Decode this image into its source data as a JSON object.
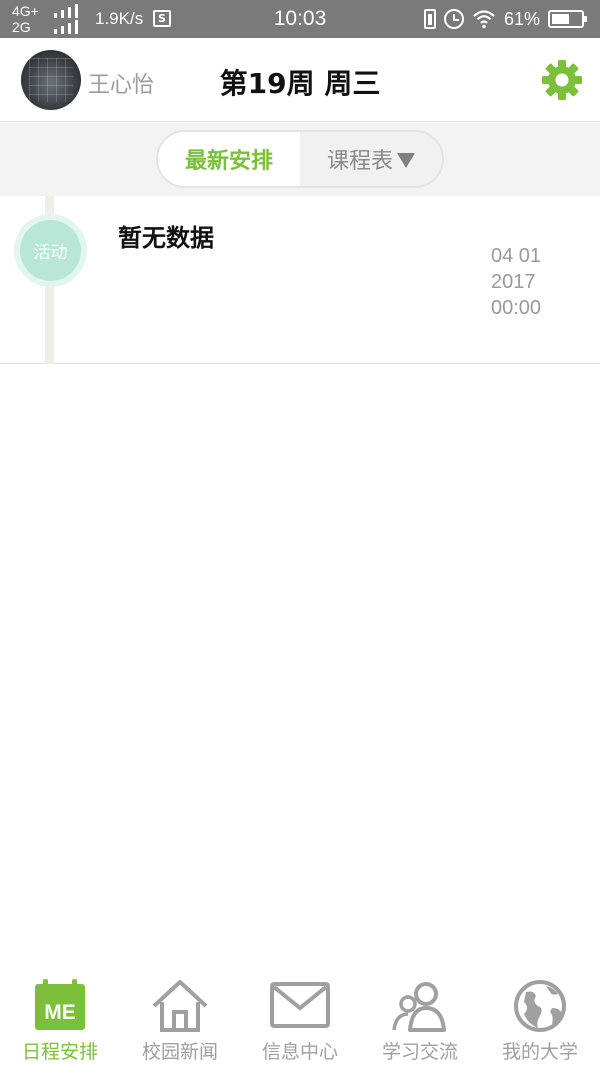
{
  "status_bar": {
    "network_top": "4G+",
    "network_bottom": "2G",
    "speed": "1.9K/s",
    "s_badge": "S",
    "time": "10:03",
    "battery": "61%",
    "battery_level": 0.61
  },
  "header": {
    "username": "王心怡",
    "week_title": "第19周 周三"
  },
  "tabs": [
    {
      "label": "最新安排",
      "active": true
    },
    {
      "label": "课程表",
      "active": false
    }
  ],
  "timeline": {
    "badge": "活动",
    "title": "暂无数据",
    "date": "04 01",
    "year": "2017",
    "time": "00:00"
  },
  "bottom_nav": [
    {
      "label": "日程安排",
      "icon": "calendar-me-icon",
      "active": true,
      "icon_text": "ME"
    },
    {
      "label": "校园新闻",
      "icon": "home-icon",
      "active": false
    },
    {
      "label": "信息中心",
      "icon": "envelope-icon",
      "active": false
    },
    {
      "label": "学习交流",
      "icon": "people-icon",
      "active": false
    },
    {
      "label": "我的大学",
      "icon": "globe-icon",
      "active": false
    }
  ],
  "colors": {
    "accent": "#7cbf3b",
    "status_bar": "#7a7a7a",
    "badge": "#b8e6d7",
    "inactive": "#a0a0a0"
  }
}
